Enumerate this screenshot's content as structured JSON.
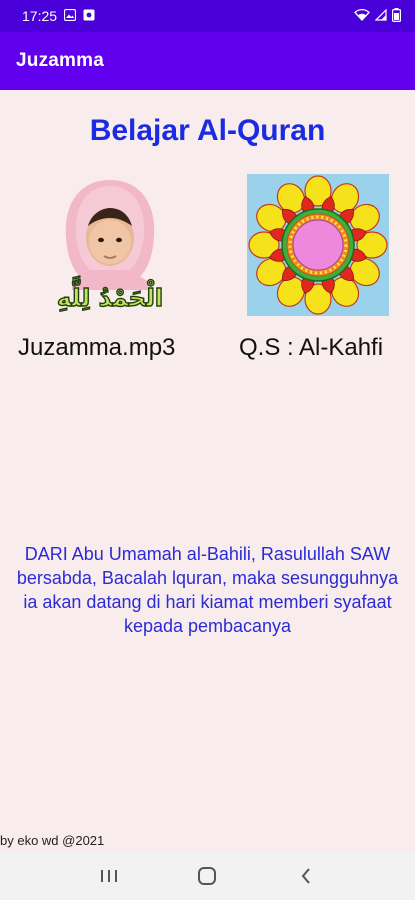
{
  "status_bar": {
    "time": "17:25"
  },
  "app_bar": {
    "title": "Juzamma"
  },
  "main": {
    "heading": "Belajar Al-Quran",
    "cards": [
      {
        "label": "Juzamma.mp3",
        "icon": "girl-hijab-alhamdulillah-image"
      },
      {
        "label": "Q.S : Al-Kahfi",
        "icon": "floral-mandala-image"
      }
    ],
    "calligraphy": "الْحَمْدُ لِلَّهِ",
    "quote": "DARI Abu Umamah al-Bahili, Rasulullah SAW bersabda, Bacalah lquran, maka sesungguhnya ia akan datang di hari kiamat memberi syafaat kepada pembacanya",
    "credit": "by eko wd @2021"
  },
  "colors": {
    "status_bar": "#4a00d8",
    "app_bar": "#6100ee",
    "background": "#f9ecec",
    "heading": "#1a2be0",
    "quote": "#2b2bd6"
  }
}
